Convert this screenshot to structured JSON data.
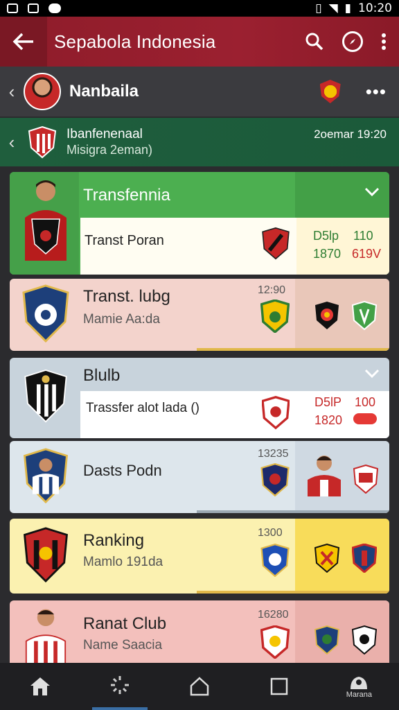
{
  "statusbar": {
    "time": "10:20"
  },
  "appbar": {
    "title": "Sepabola Indonesia"
  },
  "profile": {
    "name": "Nanbaila"
  },
  "banner": {
    "line1": "Ibanfenenaal",
    "line2": "Misigra 2eman)",
    "date": "2oemar 19:20"
  },
  "cards": [
    {
      "title": "Transfennia",
      "sub": "Transt Poran",
      "stat_a": "D5lp",
      "stat_b": "110",
      "stat_c": "1870",
      "stat_d": "619V"
    },
    {
      "title": "Transt. lubg",
      "sub": "Mamie Aa:da",
      "num": "12:90"
    },
    {
      "title": "Blulb",
      "sub": "Trassfer alot lada ()",
      "stat_a": "D5lP",
      "stat_b": "100",
      "stat_c": "1820"
    },
    {
      "title": "Dasts Podn",
      "num": "13235"
    },
    {
      "title": "Ranking",
      "sub": "Mamlo 191da",
      "num": "1300"
    },
    {
      "title": "Ranat Club",
      "sub": "Name Saacia",
      "num": "16280"
    }
  ],
  "nav": {
    "last_label": "Marana"
  },
  "colors": {
    "appbar": "#9b2030",
    "green": "#1f5e3d",
    "card_green": "#4caf50"
  }
}
